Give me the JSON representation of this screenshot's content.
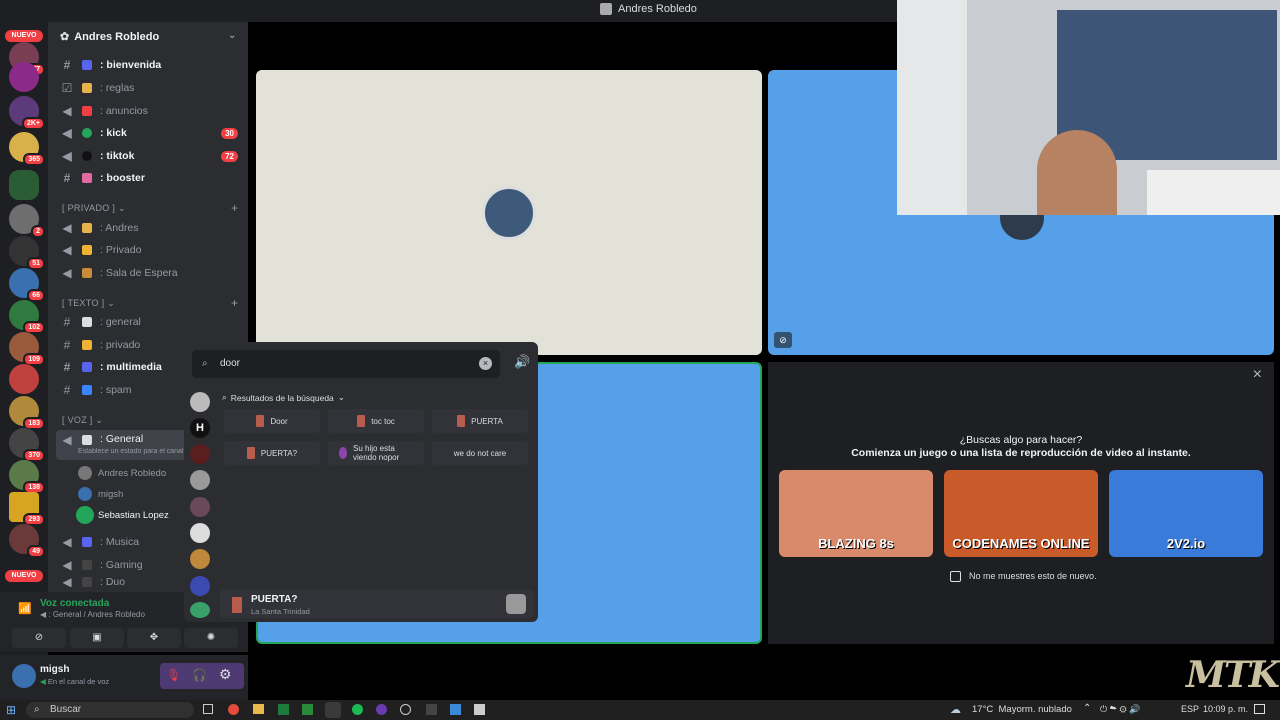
{
  "window": {
    "title": "Andres Robledo"
  },
  "servers": {
    "nuevo_top": "NUEVO",
    "nuevo_bottom": "NUEVO",
    "badges": [
      "277",
      "2K+",
      "365",
      "2",
      "51",
      "66",
      "102",
      "109",
      "183",
      "370",
      "138",
      "293",
      "49"
    ]
  },
  "server": {
    "name": "Andres Robledo"
  },
  "channels": {
    "top": [
      {
        "label": ": bienvenida",
        "bold": true
      },
      {
        "label": ": reglas"
      },
      {
        "label": ": anuncios"
      },
      {
        "label": ": kick",
        "bold": true,
        "count": "30"
      },
      {
        "label": ": tiktok",
        "bold": true,
        "count": "72"
      },
      {
        "label": ": booster",
        "bold": true
      }
    ],
    "cat_privado": "[ PRIVADO ]",
    "privado": [
      {
        "label": ": Andres"
      },
      {
        "label": ": Privado"
      },
      {
        "label": ": Sala de Espera"
      }
    ],
    "cat_texto": "[ TEXTO ]",
    "texto": [
      {
        "label": ": general"
      },
      {
        "label": ": privado"
      },
      {
        "label": ": multimedia",
        "bold": true
      },
      {
        "label": ": spam"
      }
    ],
    "cat_voz": "[ VOZ ]",
    "voz_general": ": General",
    "voz_status": "Establece un estado para el canal",
    "voice_users": [
      "Andres Robledo",
      "migsh",
      "Sebastian Lopez"
    ],
    "voz_more": [
      ": Musica",
      ": Gaming",
      ": Duo"
    ]
  },
  "voice": {
    "status": "Voz conectada",
    "location": ": General / Andres Robledo"
  },
  "user": {
    "name": "migsh",
    "status": "En el canal de voz"
  },
  "soundboard": {
    "search_value": "door",
    "results_label": "Resultados de la búsqueda",
    "sounds": [
      "Door",
      "toc toc",
      "PUERTA",
      "PUERTA?",
      "Su hijo esta viendo nopor",
      "we do not care"
    ],
    "playing_title": "PUERTA?",
    "playing_server": "La Santa Trinidad"
  },
  "activity": {
    "heading": "¿Buscas algo para hacer?",
    "subheading": "Comienza un juego o una lista de reproducción de video al instante.",
    "games": [
      "BLAZING 8s",
      "CODENAMES ONLINE",
      "2V2.io"
    ],
    "checkbox_label": "No me muestres esto de nuevo."
  },
  "taskbar": {
    "search": "Buscar",
    "weather": "17°C  Mayorm. nublado",
    "lang": "ESP",
    "time": "10:09 p. m."
  },
  "overlay": {
    "watermark": "MTK"
  },
  "colors": {
    "accent": "#5865f2",
    "danger": "#f23f43",
    "tile_blue": "#55a0e8",
    "tile_beige": "#e3e2d9",
    "online": "#23a55a"
  }
}
